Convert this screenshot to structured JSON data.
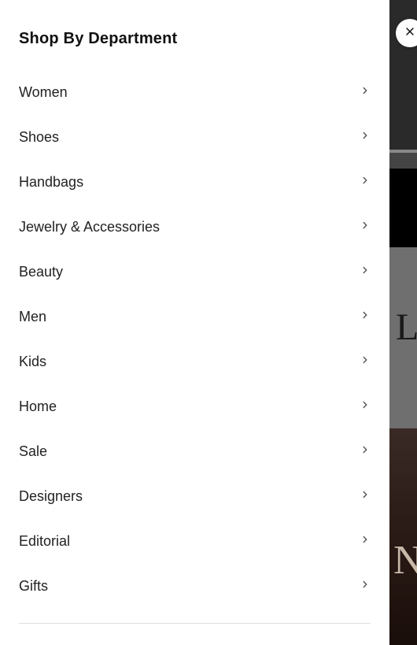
{
  "drawer": {
    "title": "Shop By Department",
    "items": [
      {
        "label": "Women"
      },
      {
        "label": "Shoes"
      },
      {
        "label": "Handbags"
      },
      {
        "label": "Jewelry & Accessories"
      },
      {
        "label": "Beauty"
      },
      {
        "label": "Men"
      },
      {
        "label": "Kids"
      },
      {
        "label": "Home"
      },
      {
        "label": "Sale"
      },
      {
        "label": "Designers"
      },
      {
        "label": "Editorial"
      },
      {
        "label": "Gifts"
      }
    ]
  },
  "backdrop": {
    "letter1": "L",
    "letter2": "N"
  }
}
